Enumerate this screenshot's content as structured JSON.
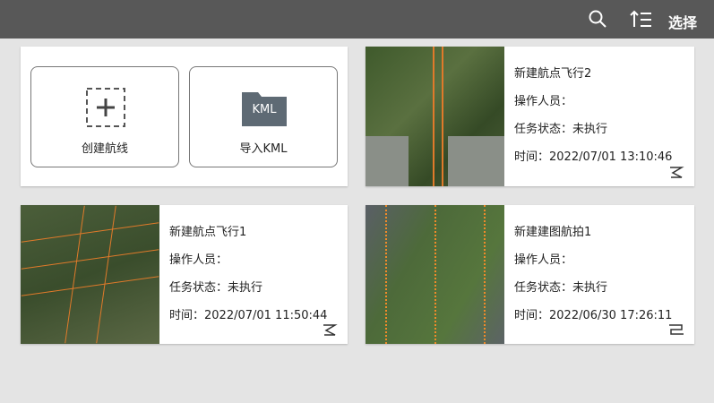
{
  "toolbar": {
    "select_label": "选择",
    "icons": [
      "search-icon",
      "sort-icon"
    ]
  },
  "actions": {
    "create_label": "创建航线",
    "import_label": "导入KML",
    "kml_badge": "KML"
  },
  "missions": [
    {
      "name": "新建航点飞行2",
      "operator": "操作人员：",
      "status": "任务状态：未执行",
      "time": "时间：2022/07/01 13:10:46",
      "type_icon": "waypoint-route-icon"
    },
    {
      "name": "新建航点飞行1",
      "operator": "操作人员：",
      "status": "任务状态：未执行",
      "time": "时间：2022/07/01 11:50:44",
      "type_icon": "waypoint-route-icon"
    },
    {
      "name": "新建建图航拍1",
      "operator": "操作人员：",
      "status": "任务状态：未执行",
      "time": "时间：2022/06/30 17:26:11",
      "type_icon": "mapping-route-icon"
    }
  ]
}
